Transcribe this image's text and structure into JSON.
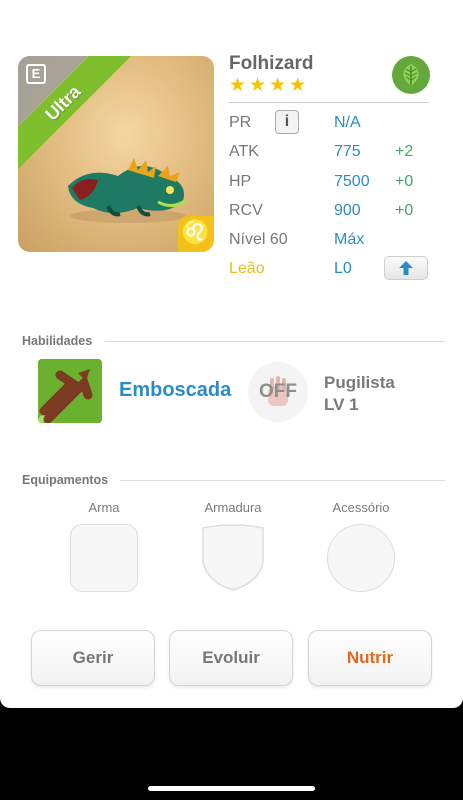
{
  "hero": {
    "name": "Folhizard",
    "stars": [
      "★",
      "★",
      "★",
      "★"
    ],
    "rarity_label": "Ultra",
    "element_icon": "leaf-icon",
    "sign_glyph": "♌",
    "equip_marker": "E"
  },
  "stats": [
    {
      "label": "PR",
      "value": "N/A",
      "bonus": ""
    },
    {
      "label": "ATK",
      "value": "775",
      "bonus": "+2"
    },
    {
      "label": "HP",
      "value": "7500",
      "bonus": "+0"
    },
    {
      "label": "RCV",
      "value": "900",
      "bonus": "+0"
    },
    {
      "label": "Nível 60",
      "value": "Máx",
      "bonus": ""
    },
    {
      "label": "Leão",
      "value": "L0",
      "bonus": ""
    }
  ],
  "info_button_label": "i",
  "skills": {
    "title": "Habilidades",
    "primary": {
      "name": "Emboscada"
    },
    "secondary": {
      "status": "OFF",
      "name_line1": "Pugilista",
      "name_line2": "LV 1"
    }
  },
  "equipment": {
    "title": "Equipamentos",
    "slots": [
      "Arma",
      "Armadura",
      "Acessório"
    ]
  },
  "actions": {
    "manage": "Gerir",
    "evolve": "Evoluir",
    "feed": "Nutrir"
  },
  "colors": {
    "accent_blue": "#2b8cc4",
    "bonus_green": "#41a85f",
    "star_yellow": "#f5c400",
    "feed_orange": "#e06a1e",
    "rarity_green": "#7fbf2e"
  }
}
